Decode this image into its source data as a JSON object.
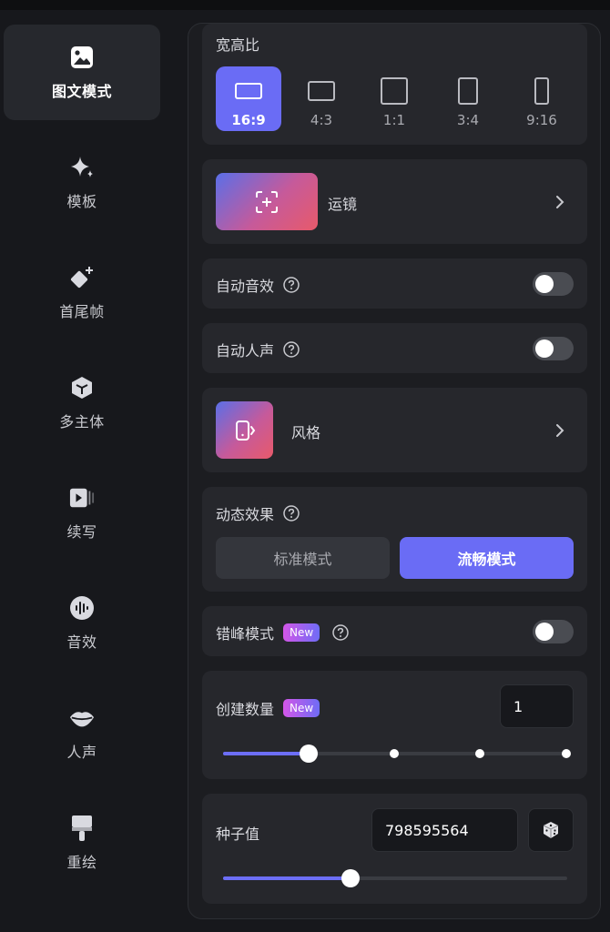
{
  "sidebar": {
    "items": [
      {
        "label": "图文模式",
        "icon": "image-icon",
        "active": true
      },
      {
        "label": "模板",
        "icon": "sparkle-icon"
      },
      {
        "label": "首尾帧",
        "icon": "diamond-plus-icon"
      },
      {
        "label": "多主体",
        "icon": "cube-icon"
      },
      {
        "label": "续写",
        "icon": "video-continue-icon"
      },
      {
        "label": "音效",
        "icon": "audio-wave-icon"
      },
      {
        "label": "人声",
        "icon": "lips-icon"
      },
      {
        "label": "重绘",
        "icon": "paintbrush-icon"
      }
    ]
  },
  "aspect": {
    "title": "宽高比",
    "selected": "16:9",
    "options": [
      "16:9",
      "4:3",
      "1:1",
      "3:4",
      "9:16"
    ]
  },
  "camera": {
    "label": "运镜",
    "icon": "camera-focus-icon"
  },
  "auto_sfx": {
    "label": "自动音效",
    "enabled": false
  },
  "auto_voice": {
    "label": "自动人声",
    "enabled": false
  },
  "style": {
    "label": "风格",
    "icon": "phone-style-icon"
  },
  "motion": {
    "label": "动态效果",
    "modes": [
      "标准模式",
      "流畅模式"
    ],
    "selected": "流畅模式"
  },
  "stagger": {
    "label": "错峰模式",
    "badge": "New",
    "enabled": false
  },
  "count": {
    "label": "创建数量",
    "badge": "New",
    "value": "1",
    "slider": {
      "min": 1,
      "max": 4,
      "value": 1
    }
  },
  "seed": {
    "label": "种子值",
    "value": "798595564",
    "random_icon": "dice-icon",
    "slider_fraction": 0.37
  },
  "colors": {
    "accent": "#6a6cf5",
    "bg": "#17181c",
    "card": "#26272c"
  }
}
